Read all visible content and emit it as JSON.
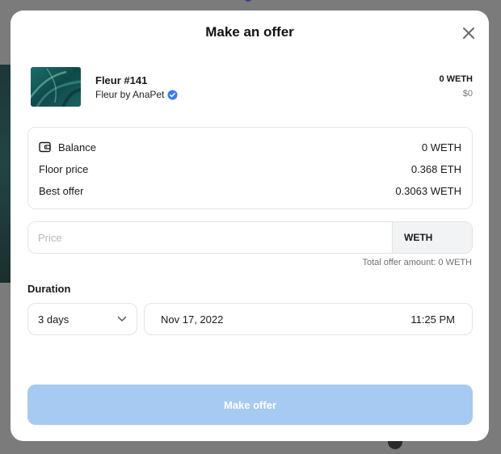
{
  "modal": {
    "title": "Make an offer"
  },
  "item": {
    "name": "Fleur #141",
    "collection": "Fleur by AnaPet",
    "price": "0 WETH",
    "usd": "$0"
  },
  "info": {
    "balance_label": "Balance",
    "balance_value": "0 WETH",
    "floor_label": "Floor price",
    "floor_value": "0.368 ETH",
    "best_offer_label": "Best offer",
    "best_offer_value": "0.3063 WETH"
  },
  "price_input": {
    "placeholder": "Price",
    "value": "",
    "currency": "WETH"
  },
  "total_offer": "Total offer amount: 0 WETH",
  "duration": {
    "label": "Duration",
    "selected": "3 days",
    "date": "Nov 17, 2022",
    "time": "11:25 PM"
  },
  "submit": {
    "label": "Make offer"
  },
  "colors": {
    "accent_disabled": "#a7caf2",
    "verified_badge": "#3b7bea"
  },
  "icons": {
    "close": "close-icon",
    "verified": "verified-badge-icon",
    "wallet": "wallet-icon",
    "chevron": "chevron-down-icon"
  }
}
